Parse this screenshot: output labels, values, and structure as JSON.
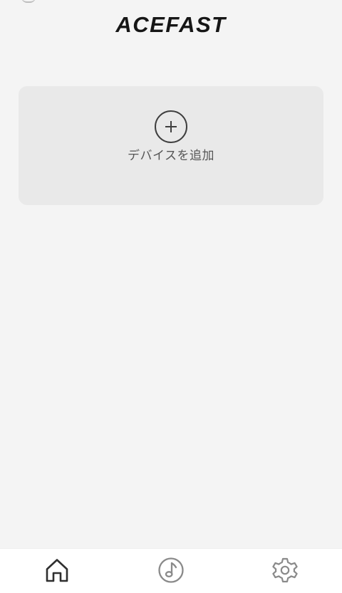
{
  "header": {
    "logo_text": "ACEFAST"
  },
  "main": {
    "add_device_label": "デバイスを追加"
  },
  "tabs": {
    "home": "home-icon",
    "music": "music-note-icon",
    "settings": "gear-icon"
  },
  "colors": {
    "background": "#f4f4f4",
    "card": "#e9e9e9",
    "tab_active": "#2f2f2f",
    "tab_inactive": "#8a8a8a"
  }
}
